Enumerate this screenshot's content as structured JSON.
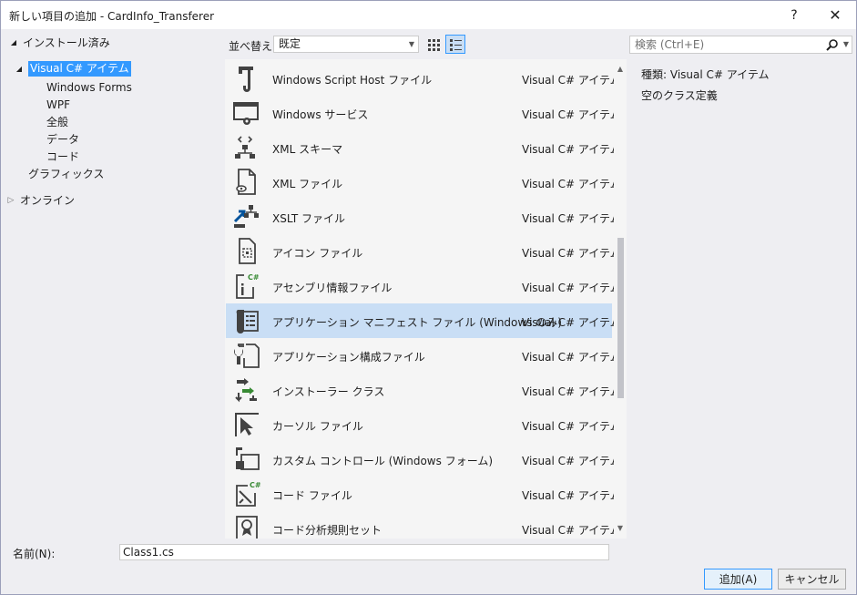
{
  "window": {
    "title": "新しい項目の追加 - CardInfo_Transferer",
    "help": "?",
    "close": "✕"
  },
  "tree": {
    "installed": "インストール済み",
    "visual_csharp": "Visual C# アイテム",
    "children": [
      "Windows Forms",
      "WPF",
      "全般",
      "データ",
      "コード"
    ],
    "graphics": "グラフィックス",
    "online": "オンライン"
  },
  "toolbar": {
    "sort_label": "並べ替え:",
    "sort_value": "既定"
  },
  "search": {
    "placeholder": "検索 (Ctrl+E)"
  },
  "items": [
    {
      "name": "Windows Script Host ファイル",
      "type": "Visual C# アイテム",
      "icon": "script-icon"
    },
    {
      "name": "Windows サービス",
      "type": "Visual C# アイテム",
      "icon": "service-icon"
    },
    {
      "name": "XML スキーマ",
      "type": "Visual C# アイテム",
      "icon": "xml-schema-icon"
    },
    {
      "name": "XML ファイル",
      "type": "Visual C# アイテム",
      "icon": "xml-file-icon"
    },
    {
      "name": "XSLT ファイル",
      "type": "Visual C# アイテム",
      "icon": "xslt-icon"
    },
    {
      "name": "アイコン ファイル",
      "type": "Visual C# アイテム",
      "icon": "icon-file-icon"
    },
    {
      "name": "アセンブリ情報ファイル",
      "type": "Visual C# アイテム",
      "icon": "assembly-info-icon"
    },
    {
      "name": "アプリケーション マニフェスト ファイル (Windows のみ)",
      "type": "Visual C# アイテム",
      "icon": "manifest-icon",
      "selected": true
    },
    {
      "name": "アプリケーション構成ファイル",
      "type": "Visual C# アイテム",
      "icon": "config-icon"
    },
    {
      "name": "インストーラー クラス",
      "type": "Visual C# アイテム",
      "icon": "installer-icon"
    },
    {
      "name": "カーソル ファイル",
      "type": "Visual C# アイテム",
      "icon": "cursor-icon"
    },
    {
      "name": "カスタム コントロール (Windows フォーム)",
      "type": "Visual C# アイテム",
      "icon": "custom-control-icon"
    },
    {
      "name": "コード ファイル",
      "type": "Visual C# アイテム",
      "icon": "code-file-icon"
    },
    {
      "name": "コード分析規則セット",
      "type": "Visual C# アイテム",
      "icon": "ruleset-icon"
    }
  ],
  "details": {
    "type_label": "種類:",
    "type_value": "Visual C# アイテム",
    "description": "空のクラス定義"
  },
  "bottom": {
    "name_label": "名前(N):",
    "name_value": "Class1.cs",
    "add_button": "追加(A)",
    "cancel_button": "キャンセル"
  },
  "colors": {
    "selection": "#3399ff",
    "selected_row": "#c9def5",
    "icon_dark": "#424242",
    "icon_blue": "#00539c",
    "icon_green": "#388a34"
  }
}
